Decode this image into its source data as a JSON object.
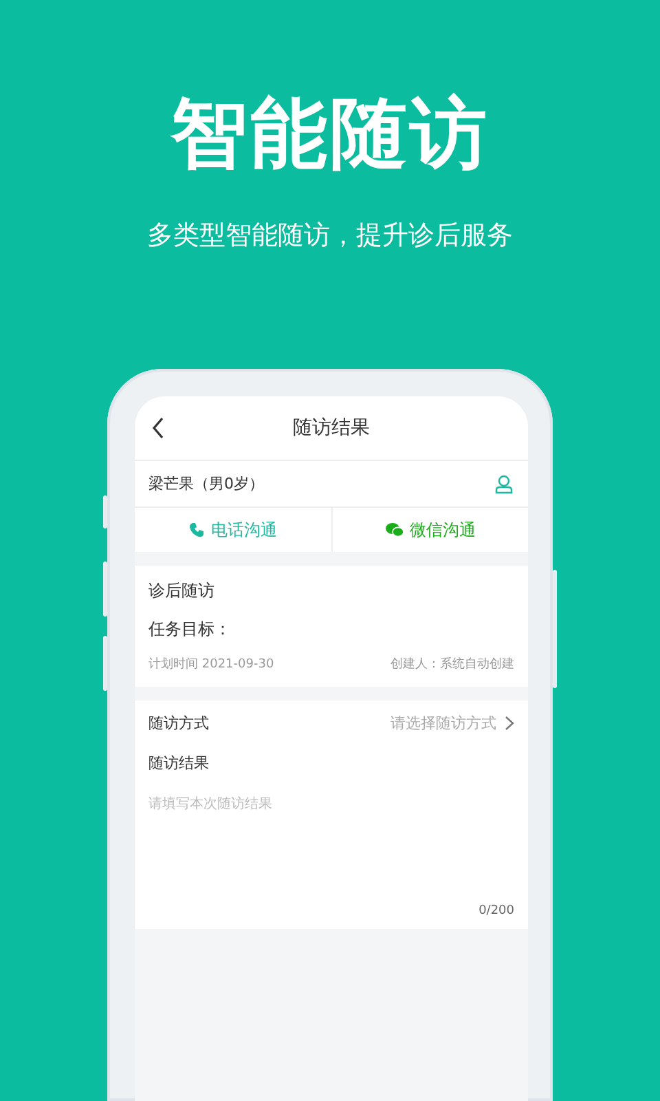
{
  "hero": {
    "title": "智能随访",
    "subtitle": "多类型智能随访，提升诊后服务"
  },
  "screen": {
    "nav": {
      "title": "随访结果"
    },
    "patient": {
      "name": "梁芒果（男0岁）"
    },
    "contact_buttons": [
      {
        "kind": "phone",
        "label": "电话沟通"
      },
      {
        "kind": "wechat",
        "label": "微信沟通"
      }
    ],
    "task": {
      "title": "诊后随访",
      "goal_label": "任务目标：",
      "plan_time": "计划时间 2021-09-30",
      "creator": "创建人：系统自动创建"
    },
    "form": {
      "method_label": "随访方式",
      "method_placeholder": "请选择随访方式",
      "result_label": "随访结果",
      "result_placeholder": "请填写本次随访结果",
      "counter": "0/200"
    }
  }
}
